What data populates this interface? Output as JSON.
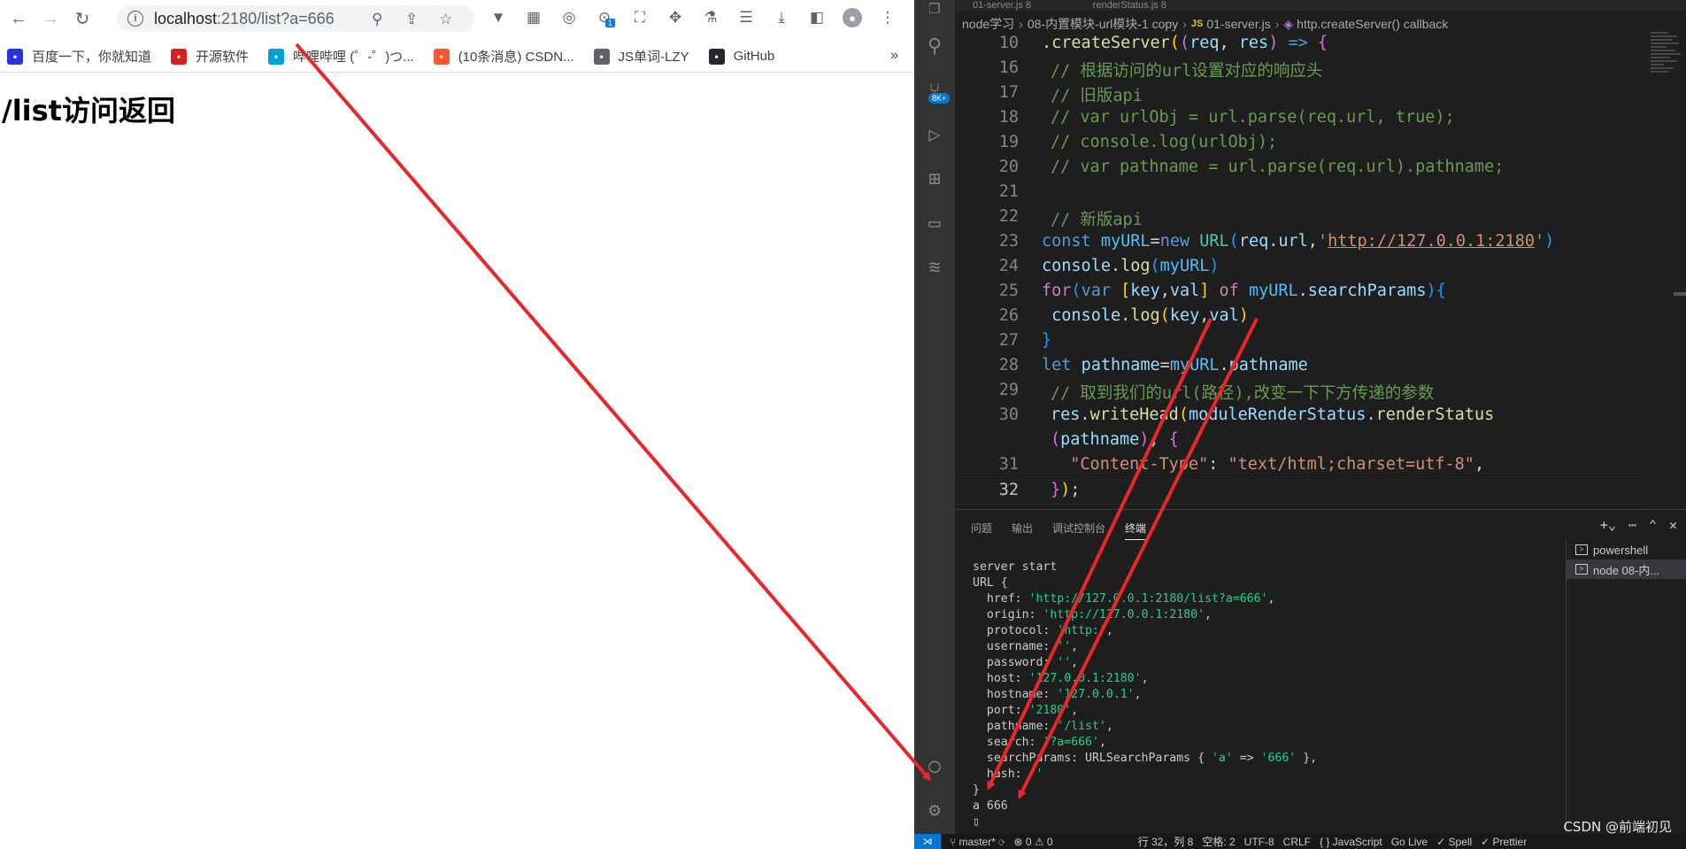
{
  "browser": {
    "url_host": "localhost",
    "url_rest": ":2180/list?a=666",
    "bookmarks": [
      {
        "label": "百度一下，你就知道",
        "color": "#2932e1"
      },
      {
        "label": "开源软件",
        "color": "#d7201d"
      },
      {
        "label": "哔哩哔哩 (゜-゜)つ...",
        "color": "#00a1d6"
      },
      {
        "label": "(10条消息) CSDN...",
        "color": "#fc5531"
      },
      {
        "label": "JS单词-LZY",
        "color": "#5f6368"
      },
      {
        "label": "GitHub",
        "color": "#24292f"
      }
    ],
    "bookmarks_more": "»",
    "page_heading": "/list访问返回",
    "ext_badge": "1"
  },
  "vscode": {
    "tabs": [
      "01-server.js 8",
      "renderStatus.js 8"
    ],
    "breadcrumb": {
      "p1": "node学习",
      "p2": "08-内置模块-url模块-1 copy",
      "js": "JS",
      "p3": "01-server.js",
      "p4": "http.createServer() callback"
    },
    "scm_badge": "8K+",
    "code_lines": [
      {
        "n": "10",
        "html": "<span class='fn'>.createServer</span><span class='br1'>(</span><span class='br2'>(</span><span class='var'>req</span>, <span class='var'>res</span><span class='br2'>)</span> <span class='kw'>=&gt;</span> <span class='br2'>{</span>",
        "indent": 2
      },
      {
        "n": "16",
        "html": "<span class='cm'>// 根据访问的url设置对应的响应头</span>",
        "indent": 3
      },
      {
        "n": "17",
        "html": "<span class='cm'>// 旧版api</span>",
        "indent": 3
      },
      {
        "n": "18",
        "html": "<span class='cm'>// var urlObj = url.parse(req.url, true);</span>",
        "indent": 3
      },
      {
        "n": "19",
        "html": "<span class='cm'>// console.log(urlObj);</span>",
        "indent": 3
      },
      {
        "n": "20",
        "html": "<span class='cm'>// var pathname = url.parse(req.url).pathname;</span>",
        "indent": 3
      },
      {
        "n": "21",
        "html": "",
        "indent": 3
      },
      {
        "n": "22",
        "html": "<span class='cm'>// 新版api</span>",
        "indent": 3
      },
      {
        "n": "23",
        "html": "<span class='kw'>const</span> <span class='const'>myURL</span>=<span class='kw'>new</span> <span class='cls'>URL</span><span class='br3'>(</span><span class='var'>req</span>.<span class='var'>url</span>,<span class='str'>'<span class='url-ul'>http://127.0.0.1:2180</span>'</span><span class='br3'>)</span>",
        "indent": 2
      },
      {
        "n": "24",
        "html": "<span class='var'>console</span>.<span class='fn'>log</span><span class='br3'>(</span><span class='const'>myURL</span><span class='br3'>)</span>",
        "indent": 2
      },
      {
        "n": "25",
        "html": "<span class='kw2'>for</span><span class='br3'>(</span><span class='kw'>var</span> <span class='br1'>[</span><span class='var'>key</span>,<span class='var'>val</span><span class='br1'>]</span> <span class='kw2'>of</span> <span class='const'>myURL</span>.<span class='var'>searchParams</span><span class='br3'>)</span><span class='br3'>{</span>",
        "indent": 2
      },
      {
        "n": "26",
        "html": " <span class='var'>console</span>.<span class='fn'>log</span><span class='br1'>(</span><span class='var'>key</span>,<span class='var'>val</span><span class='br1'>)</span>",
        "indent": 2
      },
      {
        "n": "27",
        "html": "<span class='br3'>}</span>",
        "indent": 2
      },
      {
        "n": "28",
        "html": "<span class='kw'>let</span> <span class='var'>pathname</span>=<span class='const'>myURL</span>.<span class='var'>pathname</span>",
        "indent": 2
      },
      {
        "n": "29",
        "html": "<span class='cm'>// 取到我们的url(路径),改变一下下方传递的参数</span>",
        "indent": 3
      },
      {
        "n": "30",
        "html": "<span class='var'>res</span>.<span class='fn'>writeHead</span><span class='br1'>(</span><span class='var'>moduleRenderStatus</span>.<span class='fn'>renderStatus</span>",
        "indent": 3
      },
      {
        "n": "",
        "html": "<span class='br2'>(</span><span class='var'>pathname</span><span class='br2'>)</span>, <span class='br2'>{</span>",
        "indent": 3
      },
      {
        "n": "31",
        "html": "  <span class='str'>\"Content-Type\"</span>: <span class='str'>\"text/html;charset=utf-8\"</span>,",
        "indent": 3
      },
      {
        "n": "32",
        "html": "<span class='br2'>}</span><span class='br1'>)</span>;",
        "indent": 3,
        "current": true
      }
    ],
    "panel_tabs": [
      "问题",
      "输出",
      "调试控制台",
      "终端"
    ],
    "panel_active": "终端",
    "terminal_lines": [
      "server start",
      "URL {",
      "  href: <s>'http://127.0.0.1:2180/list?a=666'</s>,",
      "  origin: <s>'http://127.0.0.1:2180'</s>,",
      "  protocol: <s>'http:'</s>,",
      "  username: <s>''</s>,",
      "  password: <s>''</s>,",
      "  host: <s>'127.0.0.1:2180'</s>,",
      "  hostname: <s>'127.0.0.1'</s>,",
      "  port: <s>'2180'</s>,",
      "  pathname: <s>'/list'</s>,",
      "  search: <s>'?a=666'</s>,",
      "  searchParams: URLSearchParams { <s>'a'</s> => <s>'666'</s> },",
      "  hash: <s>''</s>",
      "}",
      "a 666",
      "▯"
    ],
    "terminal_list": [
      {
        "label": "powershell",
        "selected": false
      },
      {
        "label": "node 08-内...",
        "selected": true
      }
    ],
    "status": {
      "branch": "master*",
      "errors": "⊗ 0 ⚠ 0",
      "position": "行 32，列 8",
      "spaces": "空格: 2",
      "encoding": "UTF-8",
      "eol": "CRLF",
      "language": "{ } JavaScript",
      "golive": "Go Live",
      "spell": "✓ Spell",
      "prettier": "✓ Prettier"
    },
    "watermark": "CSDN @前端初见"
  }
}
